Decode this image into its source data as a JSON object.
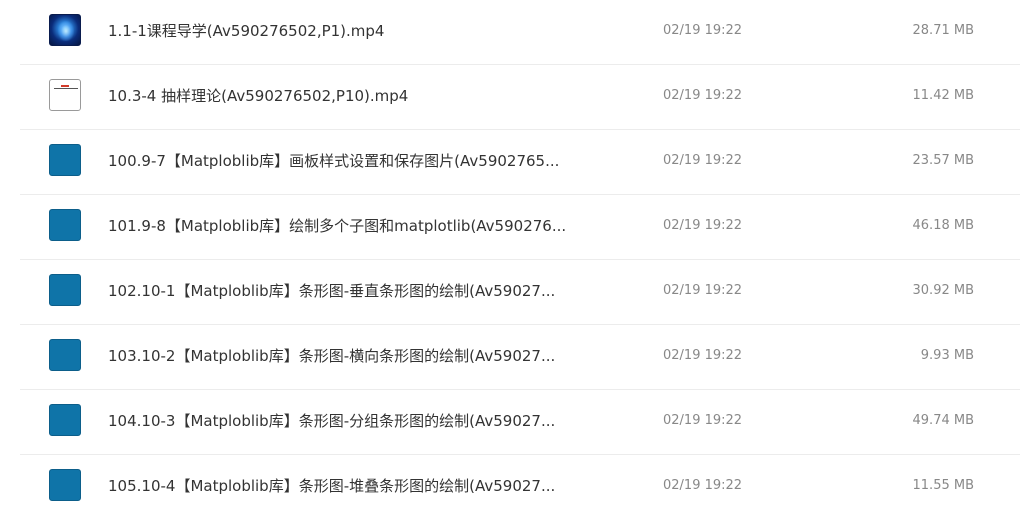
{
  "files": [
    {
      "name": "1.1-1课程导学(Av590276502,P1).mp4",
      "date": "02/19 19:22",
      "size": "28.71 MB",
      "thumb": "video-dark"
    },
    {
      "name": "10.3-4 抽样理论(Av590276502,P10).mp4",
      "date": "02/19 19:22",
      "size": "11.42 MB",
      "thumb": "video-white"
    },
    {
      "name": "100.9-7【Matploblib库】画板样式设置和保存图片(Av5902765...",
      "date": "02/19 19:22",
      "size": "23.57 MB",
      "thumb": "video-blue"
    },
    {
      "name": "101.9-8【Matploblib库】绘制多个子图和matplotlib(Av590276...",
      "date": "02/19 19:22",
      "size": "46.18 MB",
      "thumb": "video-blue"
    },
    {
      "name": "102.10-1【Matploblib库】条形图-垂直条形图的绘制(Av59027...",
      "date": "02/19 19:22",
      "size": "30.92 MB",
      "thumb": "video-blue"
    },
    {
      "name": "103.10-2【Matploblib库】条形图-横向条形图的绘制(Av59027...",
      "date": "02/19 19:22",
      "size": "9.93 MB",
      "thumb": "video-blue"
    },
    {
      "name": "104.10-3【Matploblib库】条形图-分组条形图的绘制(Av59027...",
      "date": "02/19 19:22",
      "size": "49.74 MB",
      "thumb": "video-blue"
    },
    {
      "name": "105.10-4【Matploblib库】条形图-堆叠条形图的绘制(Av59027...",
      "date": "02/19 19:22",
      "size": "11.55 MB",
      "thumb": "video-blue"
    }
  ],
  "colors": {
    "thumb_blue": "#0f74a8",
    "text_primary": "#333333",
    "text_secondary": "#888888",
    "divider": "#ececec"
  }
}
